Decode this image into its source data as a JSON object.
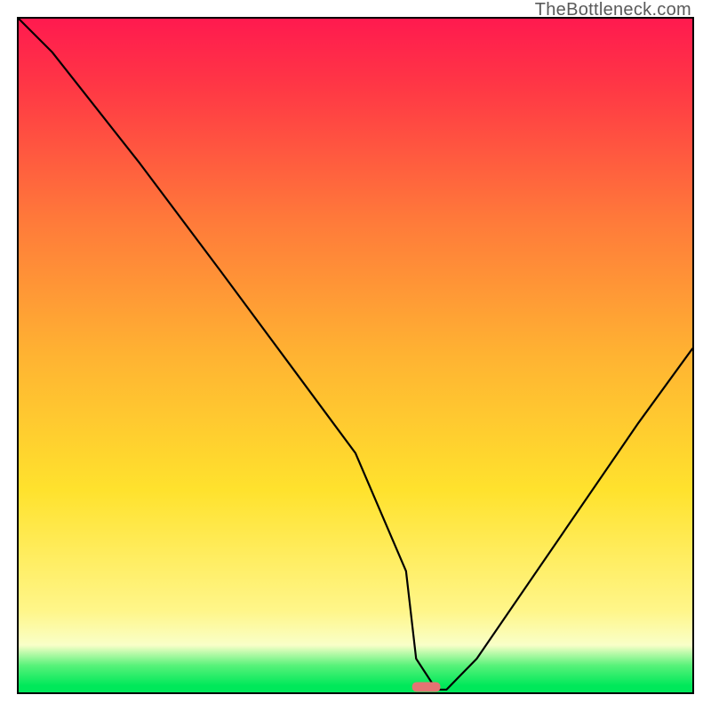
{
  "watermark": "TheBottleneck.com",
  "chart_data": {
    "type": "line",
    "title": "",
    "xlabel": "",
    "ylabel": "",
    "xlim": [
      0,
      100
    ],
    "ylim": [
      0,
      100
    ],
    "grid": false,
    "series": [
      {
        "name": "bottleneck-curve",
        "x": [
          0,
          5,
          18,
          30,
          40,
          50,
          57.5,
          59,
          62,
          63.5,
          68,
          80,
          92,
          100
        ],
        "values": [
          100,
          95,
          78.5,
          62.5,
          49,
          35.5,
          18,
          5,
          0.4,
          0.4,
          5,
          22.5,
          40,
          51
        ]
      }
    ],
    "marker": {
      "name": "optimal-point",
      "x": 60.5,
      "y": 0.8,
      "color": "#e57373"
    },
    "background_gradient_stops": [
      {
        "pos": 0.0,
        "color": "#ff1a4f"
      },
      {
        "pos": 0.1,
        "color": "#ff3745"
      },
      {
        "pos": 0.3,
        "color": "#ff7a3a"
      },
      {
        "pos": 0.5,
        "color": "#ffb332"
      },
      {
        "pos": 0.7,
        "color": "#ffe22d"
      },
      {
        "pos": 0.88,
        "color": "#fff68a"
      },
      {
        "pos": 0.93,
        "color": "#f9ffc8"
      },
      {
        "pos": 0.96,
        "color": "#58f27a"
      },
      {
        "pos": 0.99,
        "color": "#00e85a"
      },
      {
        "pos": 1.0,
        "color": "#00e85a"
      }
    ]
  }
}
